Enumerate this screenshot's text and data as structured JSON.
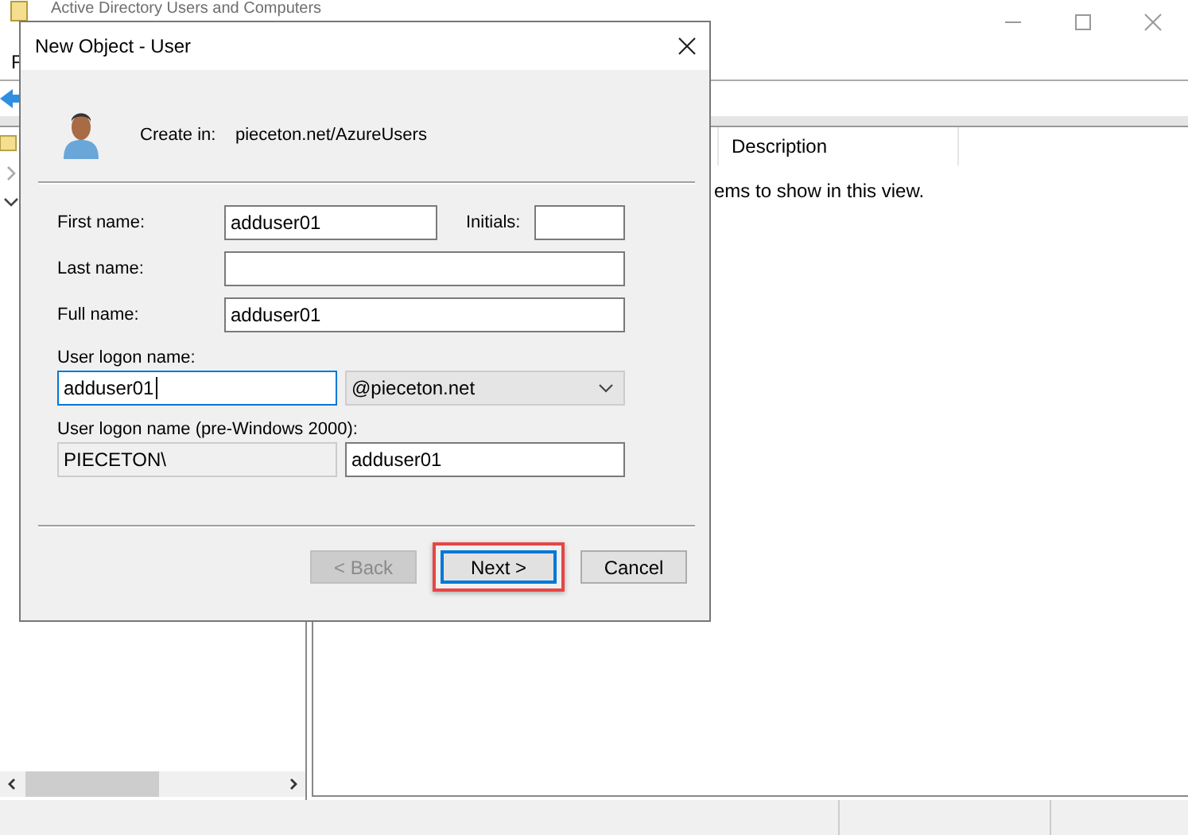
{
  "background_window": {
    "title": "Active Directory Users and Computers",
    "menu": [
      "F"
    ],
    "columns": [
      "Description"
    ],
    "empty_message": "ems to show in this view."
  },
  "dialog": {
    "title": "New Object - User",
    "create_in_label": "Create in:",
    "create_in_path": "pieceton.net/AzureUsers",
    "first_name": {
      "label": "First name:",
      "value": "adduser01"
    },
    "initials": {
      "label": "Initials:"
    },
    "last_name": {
      "label": "Last name:"
    },
    "full_name": {
      "label": "Full name:",
      "value": "adduser01"
    },
    "logon_name": {
      "label": "User logon name:",
      "value": "adduser01",
      "focused": true
    },
    "domain": {
      "value": "@pieceton.net"
    },
    "pre2000": {
      "label": "User logon name (pre-Windows 2000):",
      "prefix": "PIECETON\\",
      "value": "adduser01"
    },
    "buttons": [
      {
        "label": "< Back",
        "disabled": true,
        "default": false,
        "highlighted": false
      },
      {
        "label": "Next >",
        "disabled": false,
        "default": true,
        "highlighted": true
      },
      {
        "label": "Cancel",
        "disabled": false,
        "default": false,
        "highlighted": false
      }
    ]
  }
}
